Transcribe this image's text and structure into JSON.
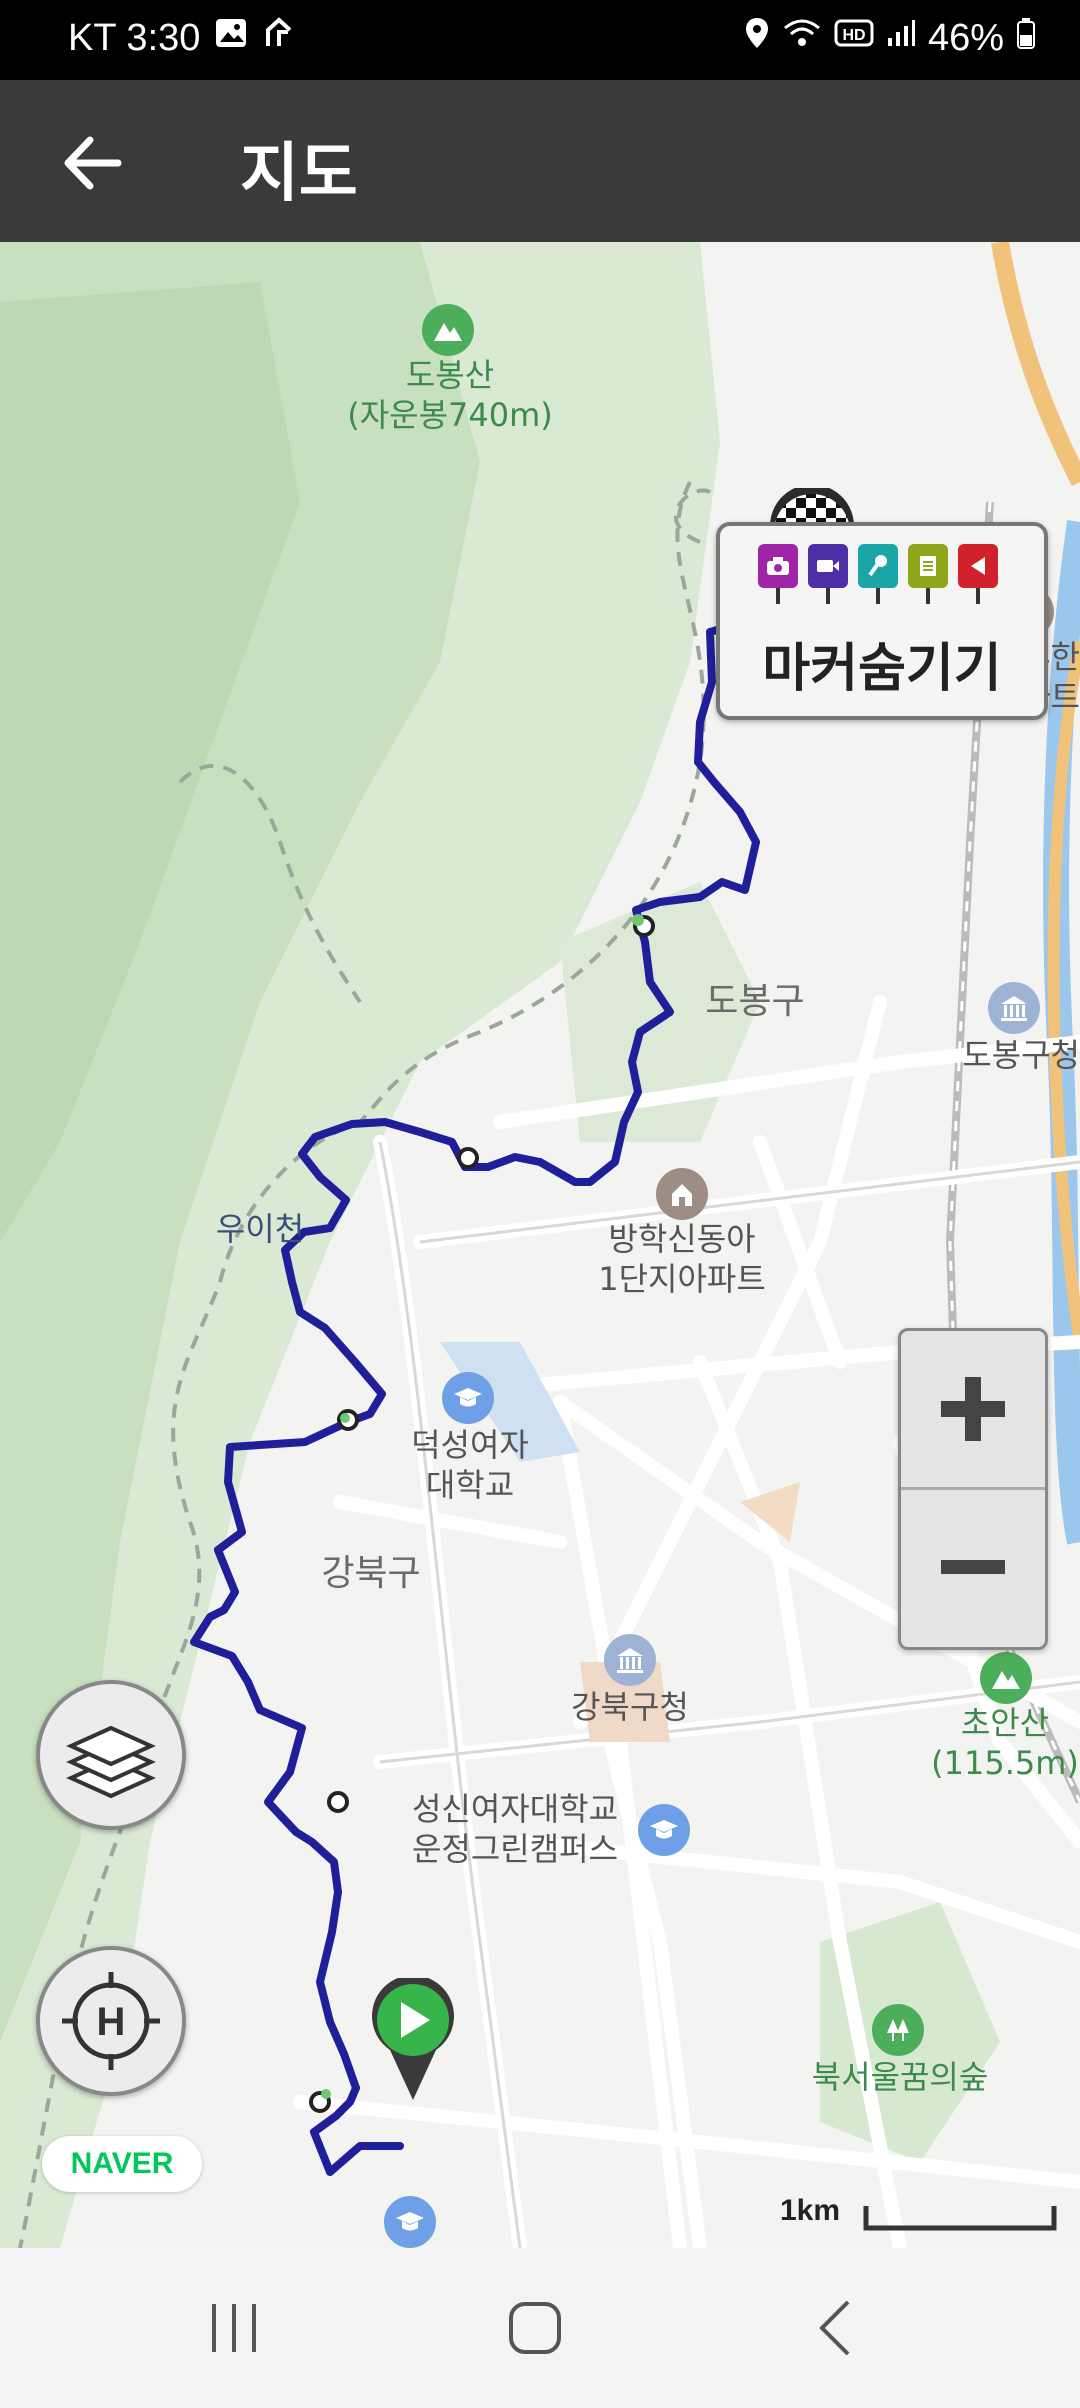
{
  "status_bar": {
    "carrier_time": "KT 3:30",
    "battery": "46%"
  },
  "app_bar": {
    "title": "지도"
  },
  "marker_toggle": {
    "label": "마커숨기기"
  },
  "map": {
    "labels": {
      "dobongsan": "도봉산",
      "dobongsan_sub": "(자운봉740m)",
      "dobong_hyuhan": "도봉휴한",
      "dobong_hyuhan2": "아파트",
      "dobonggu": "도봉구",
      "dobonggu_office": "도봉구청",
      "ui_stream": "우이천",
      "banghak": "방학신동아",
      "banghak2": "1단지아파트",
      "duksung": "덕성여자",
      "duksung2": "대학교",
      "gangbukgu": "강북구",
      "gangbuk_office": "강북구청",
      "choansan": "초안산",
      "choansan_sub": "(115.5m)",
      "sungshin": "성신여자대학교",
      "sungshin2": "운정그린캠퍼스",
      "bukseoul": "북서울꿈의숲"
    },
    "scale_label": "1km",
    "brand": "NAVER"
  },
  "colors": {
    "route": "#1f1f9a",
    "appbar": "#3a3a3a",
    "naver": "#03c75a"
  }
}
